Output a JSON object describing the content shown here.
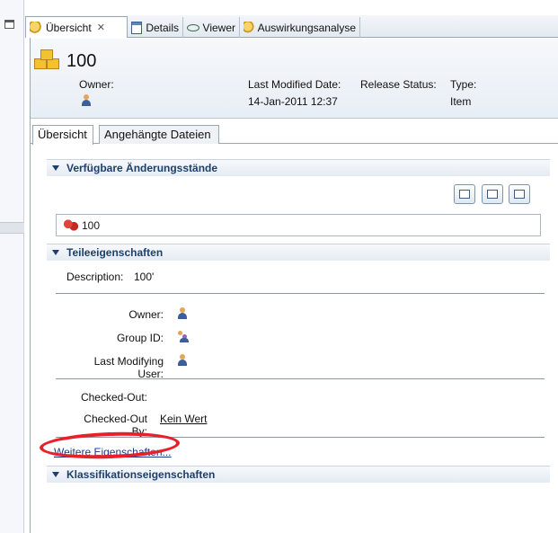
{
  "editor_tabs": [
    {
      "label": "Übersicht",
      "icon": "item-star-icon",
      "active": true
    },
    {
      "label": "Details",
      "icon": "details-icon",
      "active": false
    },
    {
      "label": "Viewer",
      "icon": "viewer-glasses-icon",
      "active": false
    },
    {
      "label": "Auswirkungsanalyse",
      "icon": "impact-analysis-icon",
      "active": false
    }
  ],
  "header": {
    "title": "100",
    "owner_label": "Owner:",
    "last_modified_label": "Last Modified Date:",
    "last_modified_value": "14-Jan-2011 12:37",
    "release_status_label": "Release Status:",
    "type_label": "Type:",
    "type_value": "Item"
  },
  "inner_tabs": [
    {
      "label": "Übersicht",
      "active": true
    },
    {
      "label": "Angehängte Dateien",
      "active": false
    }
  ],
  "sections": {
    "revisions_title": "Verfügbare Änderungsstände",
    "revision_item": "100",
    "properties_title": "Teileeigenschaften",
    "classification_title": "Klassifikationseigenschaften"
  },
  "properties": {
    "description_label": "Description:",
    "description_value": "100'",
    "owner_label": "Owner:",
    "group_label": "Group ID:",
    "last_user_label": "Last Modifying User:",
    "checked_out_label": "Checked-Out:",
    "checked_out_by_label": "Checked-Out By:",
    "checked_out_by_value": "Kein Wert"
  },
  "more_link": "Weitere Eigenschaften...",
  "colors": {
    "section_title": "#1d3f6a",
    "annotation_circle": "#e8202a",
    "link": "#1a3a8a"
  }
}
